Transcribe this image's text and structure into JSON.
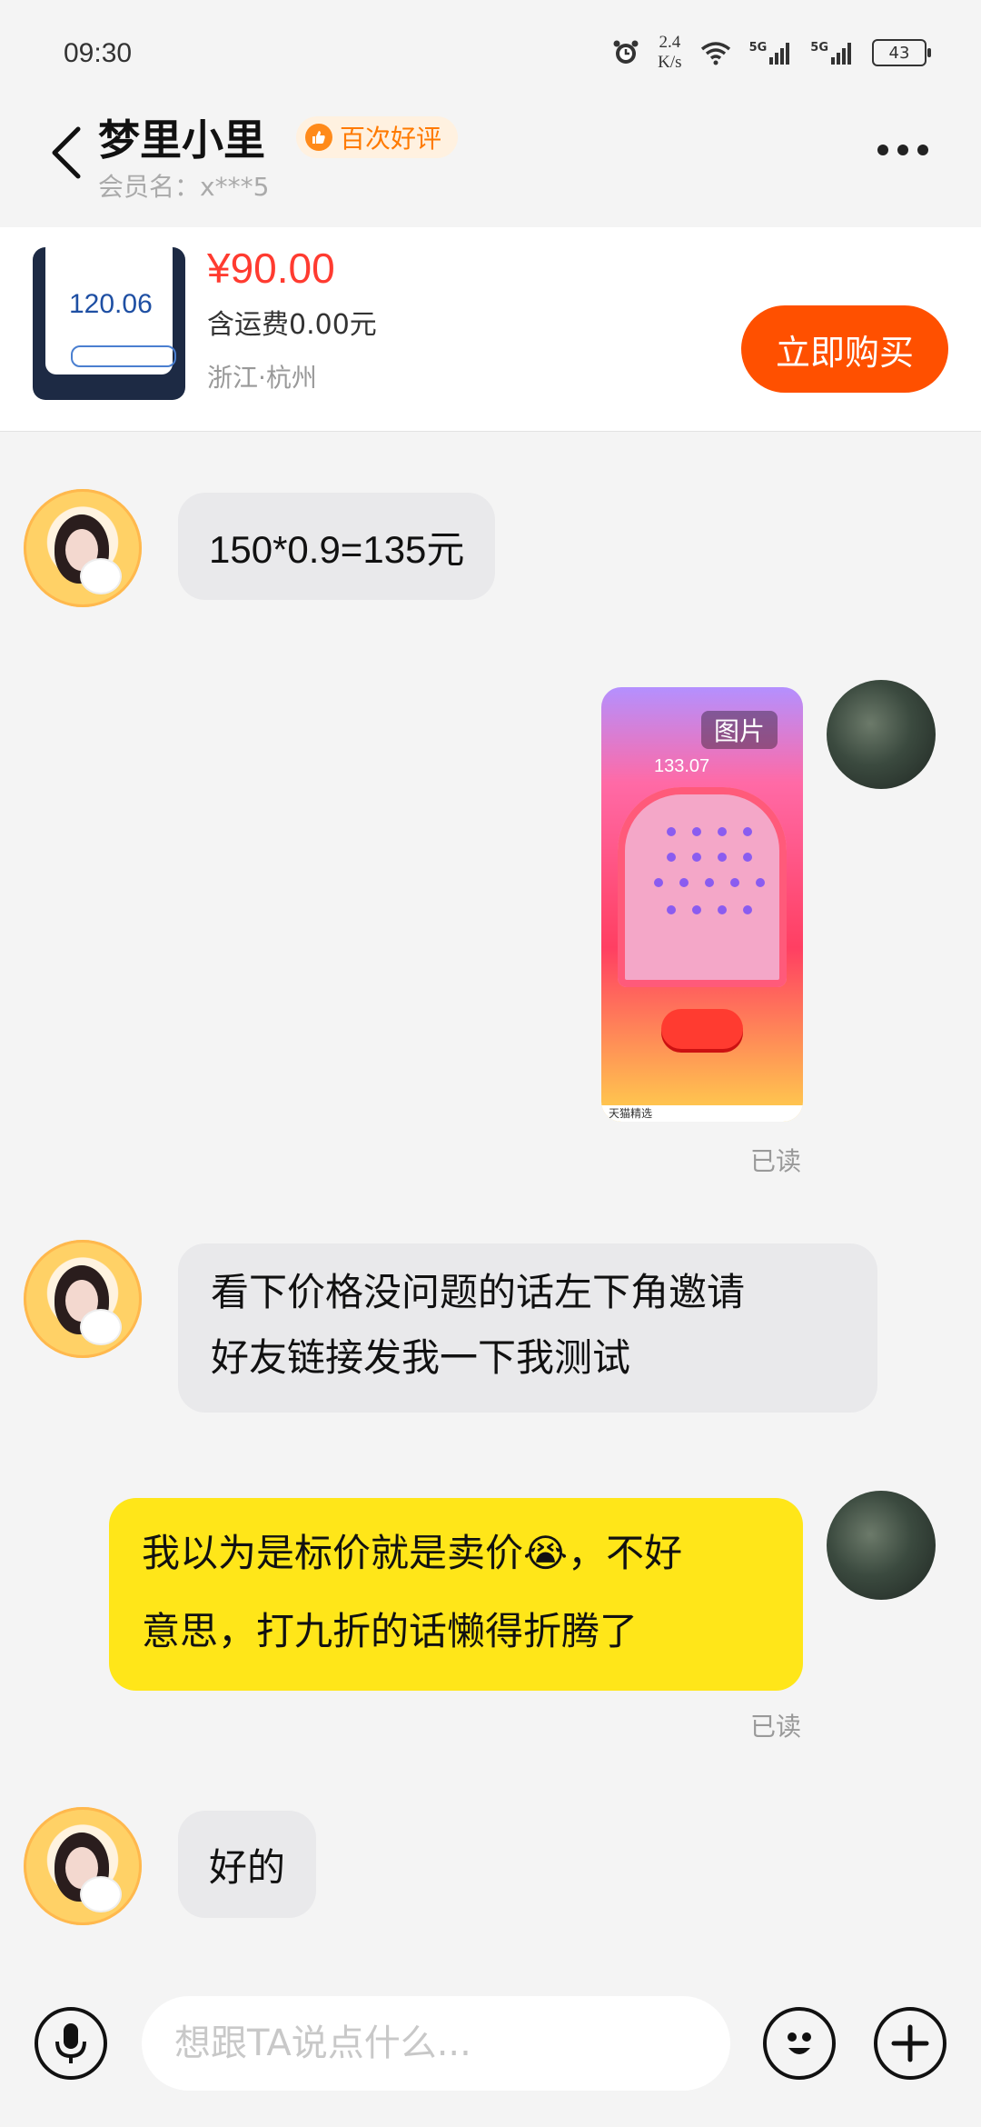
{
  "status_bar": {
    "time": "09:30",
    "speed_value": "2.4",
    "speed_unit": "K/s",
    "network_1": "5G",
    "network_2": "5G",
    "battery": "43"
  },
  "header": {
    "title": "梦里小里",
    "badge": "百次好评",
    "member_name": "会员名：x***5"
  },
  "product": {
    "thumb_value": "120.06",
    "price": "¥90.00",
    "shipping": "含运费0.00元",
    "location": "浙江·杭州",
    "buy_label": "立即购买"
  },
  "messages": [
    {
      "from": "seller",
      "text": "150*0.9=135元"
    },
    {
      "from": "me",
      "type": "image",
      "label": "图片",
      "amount": "133.07",
      "footer": "天猫精选",
      "status": "已读"
    },
    {
      "from": "seller",
      "line1": "看下价格没问题的话左下角邀请",
      "line2": "好友链接发我一下我测试"
    },
    {
      "from": "me",
      "line1_a": "我以为是标价就是卖价",
      "emoji": "😭",
      "line1_b": "，不好",
      "line2": "意思，打九折的话懒得折腾了",
      "status": "已读"
    },
    {
      "from": "seller",
      "text": "好的"
    }
  ],
  "input_bar": {
    "placeholder": "想跟TA说点什么..."
  },
  "icons": [
    "back-icon",
    "more-icon",
    "thumbs-up-icon",
    "microphone-icon",
    "emoji-icon",
    "plus-icon",
    "wifi-icon",
    "alarm-icon"
  ],
  "colors": {
    "accent_orange": "#ff5000",
    "price_red": "#ff3b30",
    "out_bubble": "#ffe619",
    "in_bubble": "#e9e9eb"
  }
}
